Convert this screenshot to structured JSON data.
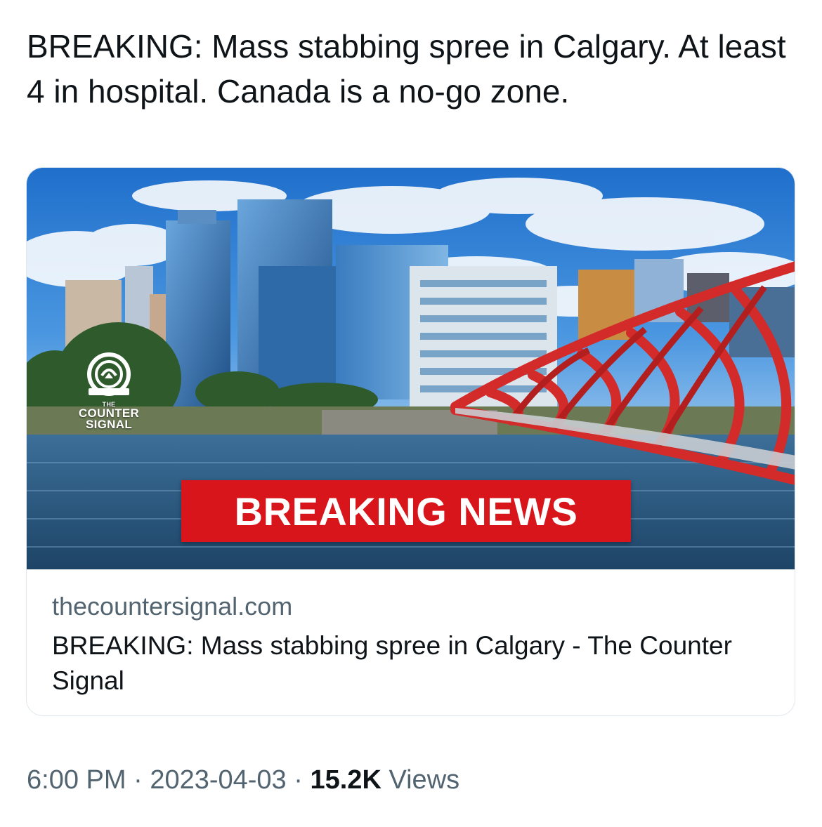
{
  "tweet": {
    "text": "BREAKING: Mass stabbing spree in Calgary. At least 4 in hospital. Canada is a no-go zone."
  },
  "card": {
    "logo": {
      "line1": "THE",
      "line2": "COUNTER",
      "line3": "SIGNAL"
    },
    "banner_text": "BREAKING NEWS",
    "domain": "thecountersignal.com",
    "title": "BREAKING: Mass stabbing spree in Calgary - The Counter Signal"
  },
  "meta": {
    "time": "6:00 PM",
    "separator": "·",
    "date": "2023-04-03",
    "views_count": "15.2K",
    "views_label": "Views"
  },
  "colors": {
    "banner": "#d7151b",
    "bridge": "#d32a2a",
    "sky": "#2f7fd6",
    "river": "#2b5e88"
  },
  "icons": [
    "broadcast-logo-icon"
  ]
}
